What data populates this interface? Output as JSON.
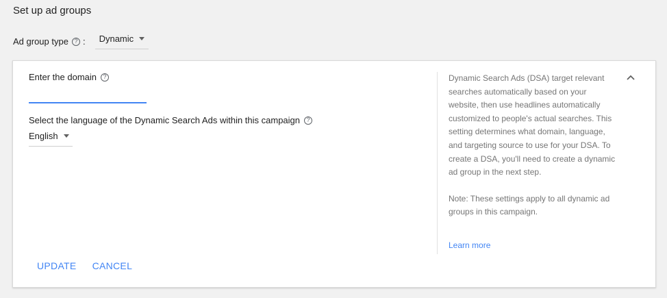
{
  "page": {
    "title": "Set up ad groups"
  },
  "ad_group_type": {
    "label": "Ad group type",
    "help_icon": "?",
    "colon": ":",
    "selected": "Dynamic"
  },
  "form": {
    "domain_label": "Enter the domain",
    "domain_value": "",
    "language_label": "Select the language of the Dynamic Search Ads within this campaign",
    "language_selected": "English",
    "update_label": "UPDATE",
    "cancel_label": "CANCEL"
  },
  "help": {
    "description": "Dynamic Search Ads (DSA) target relevant searches automatically based on your website, then use headlines automatically customized to people's actual searches. This setting determines what domain, language, and targeting source to use for your DSA. To create a DSA, you'll need to create a dynamic ad group in the next step.",
    "note": "Note: These settings apply to all dynamic ad groups in this campaign.",
    "learn_more": "Learn more"
  },
  "icons": {
    "help": "help-circle-icon",
    "dropdown": "caret-down-icon",
    "collapse": "chevron-up-icon"
  },
  "colors": {
    "accent": "#4285f4",
    "secondary_text": "#757575",
    "background": "#f1f1f1"
  }
}
